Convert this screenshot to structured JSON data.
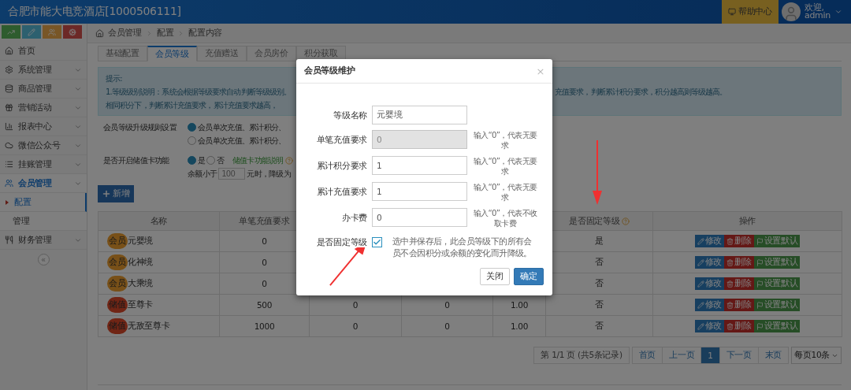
{
  "header": {
    "title": "合肥市能大电竞酒店[1000506111]",
    "help": "帮助中心",
    "greeting": "欢迎,",
    "user": "admin"
  },
  "sidebar": {
    "items": [
      {
        "label": "首页",
        "kind": "link"
      },
      {
        "label": "系统管理",
        "kind": "group",
        "expanded": false
      },
      {
        "label": "商品管理",
        "kind": "group",
        "expanded": false
      },
      {
        "label": "营销活动",
        "kind": "group",
        "expanded": false
      },
      {
        "label": "报表中心",
        "kind": "group",
        "expanded": false
      },
      {
        "label": "微信公众号",
        "kind": "group",
        "expanded": false
      },
      {
        "label": "挂账管理",
        "kind": "group",
        "expanded": false
      },
      {
        "label": "会员管理",
        "kind": "group",
        "expanded": true,
        "children": [
          {
            "label": "配置",
            "selected": true
          },
          {
            "label": "管理",
            "selected": false
          }
        ]
      },
      {
        "label": "财务管理",
        "kind": "group",
        "expanded": false
      }
    ],
    "collapse": "«"
  },
  "breadcrumb": [
    "会员管理",
    "配置",
    "配置内容"
  ],
  "tabs": [
    {
      "label": "基础配置",
      "selected": false
    },
    {
      "label": "会员等级",
      "selected": true
    },
    {
      "label": "充值赠送",
      "selected": false
    },
    {
      "label": "会员房价",
      "selected": false
    },
    {
      "label": "积分获取",
      "selected": false
    }
  ],
  "notice": {
    "title": "提示:",
    "lines": [
      {
        "left": "1.等级级别说明：系统会根据等级要求自动判断等级级别。",
        "right": "充值要求，判断累计积分要求，积分越高则等级越高。"
      },
      {
        "left": "相同积分下，判断累计充值要求，累计充值要求越高，"
      }
    ]
  },
  "upgrade_rule": {
    "label": "会员等级升级规则设置",
    "options": [
      {
        "label": "会员单次充值、累计积分、",
        "selected": true
      },
      {
        "label": "会员单次充值、累计积分、",
        "selected": false
      }
    ]
  },
  "stored_value": {
    "label": "是否开启储值卡功能",
    "options": [
      {
        "label": "是",
        "selected": true
      },
      {
        "label": "否",
        "selected": false
      }
    ],
    "link": "储值卡功能说明",
    "prefix": "余额小于",
    "value": "100",
    "suffix": "元时，降级为"
  },
  "add_button": "新增",
  "table": {
    "columns": [
      {
        "label": "名称"
      },
      {
        "label": "单笔充值要求"
      },
      null,
      null,
      null,
      {
        "label": "是否固定等级",
        "help": true
      },
      {
        "label": "操作"
      }
    ],
    "rows": [
      {
        "badge": {
          "text": "会员",
          "kind": "member"
        },
        "cells": [
          "元婴境",
          "0",
          null,
          null,
          null,
          "是"
        ],
        "actions": [
          {
            "kind": "edit",
            "label": "修改"
          },
          {
            "kind": "delete",
            "label": "删除"
          },
          {
            "kind": "default",
            "label": "设置默认"
          }
        ]
      },
      {
        "badge": {
          "text": "会员",
          "kind": "member"
        },
        "cells": [
          "化神境",
          "0",
          null,
          null,
          null,
          "否"
        ],
        "actions": [
          {
            "kind": "edit",
            "label": "修改"
          },
          {
            "kind": "delete",
            "label": "删除"
          },
          {
            "kind": "default",
            "label": "设置默认"
          }
        ]
      },
      {
        "badge": {
          "text": "会员",
          "kind": "member"
        },
        "cells": [
          "大乘境",
          "0",
          null,
          null,
          null,
          "否"
        ],
        "actions": [
          {
            "kind": "edit",
            "label": "修改"
          },
          {
            "kind": "delete",
            "label": "删除"
          },
          {
            "kind": "default",
            "label": "设置默认"
          }
        ]
      },
      {
        "badge": {
          "text": "储值",
          "kind": "stored"
        },
        "cells": [
          "至尊卡",
          "500",
          "0",
          "0",
          "1.00",
          "否"
        ],
        "actions": [
          {
            "kind": "edit",
            "label": "修改"
          },
          {
            "kind": "delete",
            "label": "删除"
          },
          {
            "kind": "default",
            "label": "设置默认"
          }
        ]
      },
      {
        "badge": {
          "text": "储值",
          "kind": "stored"
        },
        "cells": [
          "无敌至尊卡",
          "1000",
          "0",
          "0",
          "1.00",
          "否"
        ],
        "actions": [
          {
            "kind": "edit",
            "label": "修改"
          },
          {
            "kind": "delete",
            "label": "删除"
          },
          {
            "kind": "default",
            "label": "设置默认"
          }
        ]
      }
    ]
  },
  "pagination": {
    "info": "第 1/1 页 (共5条记录)",
    "pages": [
      {
        "label": "首页",
        "selected": false
      },
      {
        "label": "上一页",
        "selected": false
      },
      {
        "label": "1",
        "selected": true
      },
      {
        "label": "下一页",
        "selected": false
      },
      {
        "label": "末页",
        "selected": false
      }
    ],
    "page_size": "每页10条"
  },
  "modal": {
    "title": "会员等级维护",
    "close": "×",
    "fields": [
      {
        "label": "等级名称",
        "value": "元婴境",
        "disabled": false
      },
      {
        "label": "单笔充值要求",
        "value": "0",
        "disabled": true,
        "hint": "输入“0”，代表无要求"
      },
      {
        "label": "累计积分要求",
        "value": "1",
        "disabled": false,
        "hint": "输入“0”，代表无要求"
      },
      {
        "label": "累计充值要求",
        "value": "1",
        "disabled": false,
        "hint": "输入“0”，代表无要求"
      },
      {
        "label": "办卡费",
        "value": "0",
        "disabled": false,
        "hint": "输入“0”，代表不收取卡费"
      }
    ],
    "fixed": {
      "label": "是否固定等级",
      "checked": true,
      "description": "选中并保存后，此会员等级下的所有会员不会因积分或余额的变化而升降级。"
    },
    "buttons": [
      {
        "kind": "secondary",
        "label": "关闭"
      },
      {
        "kind": "primary",
        "label": "确定"
      }
    ]
  }
}
